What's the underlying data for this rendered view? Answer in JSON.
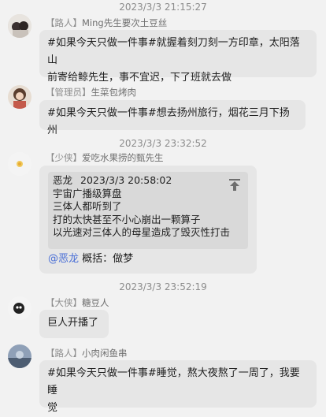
{
  "messages": [
    {
      "time": "2023/3/3 21:15:27",
      "role": "【路人】",
      "name": "Ming先生要次土豆丝",
      "lines": [
        "#如果今天只做一件事#就握着刻刀刻一方印章，太阳落山",
        "前寄给鲸先生，事不宜迟，下了班就去做"
      ]
    },
    {
      "role": "【管理员】",
      "name": "生菜包烤肉",
      "lines": [
        "#如果今天只做一件事#想去扬州旅行，烟花三月下扬州"
      ]
    },
    {
      "time": "2023/3/3 23:32:52",
      "role": "【少侠】",
      "name": "爱吃水果捞的甄先生",
      "quote": {
        "author": "恶龙",
        "time": "2023/3/3 20:58:02",
        "lines": [
          "宇宙广播级算盘",
          "三体人都听到了",
          "打的太快甚至不小心崩出一颗算子",
          "以光速对三体人的母星造成了毁灭性打击"
        ]
      },
      "mention": "@恶龙",
      "reply": "概括：做梦"
    },
    {
      "time": "2023/3/3 23:52:19",
      "role": "【大侠】",
      "name": "糖豆人",
      "lines": [
        "巨人开播了"
      ]
    },
    {
      "role": "【路人】",
      "name": "小肉闲鱼串",
      "lines": [
        "#如果今天只做一件事#睡觉，熬大夜熬了一周了，我要睡",
        "觉"
      ]
    }
  ],
  "icons": {
    "jump_to_quote": "arrow-up-to-line-icon"
  }
}
